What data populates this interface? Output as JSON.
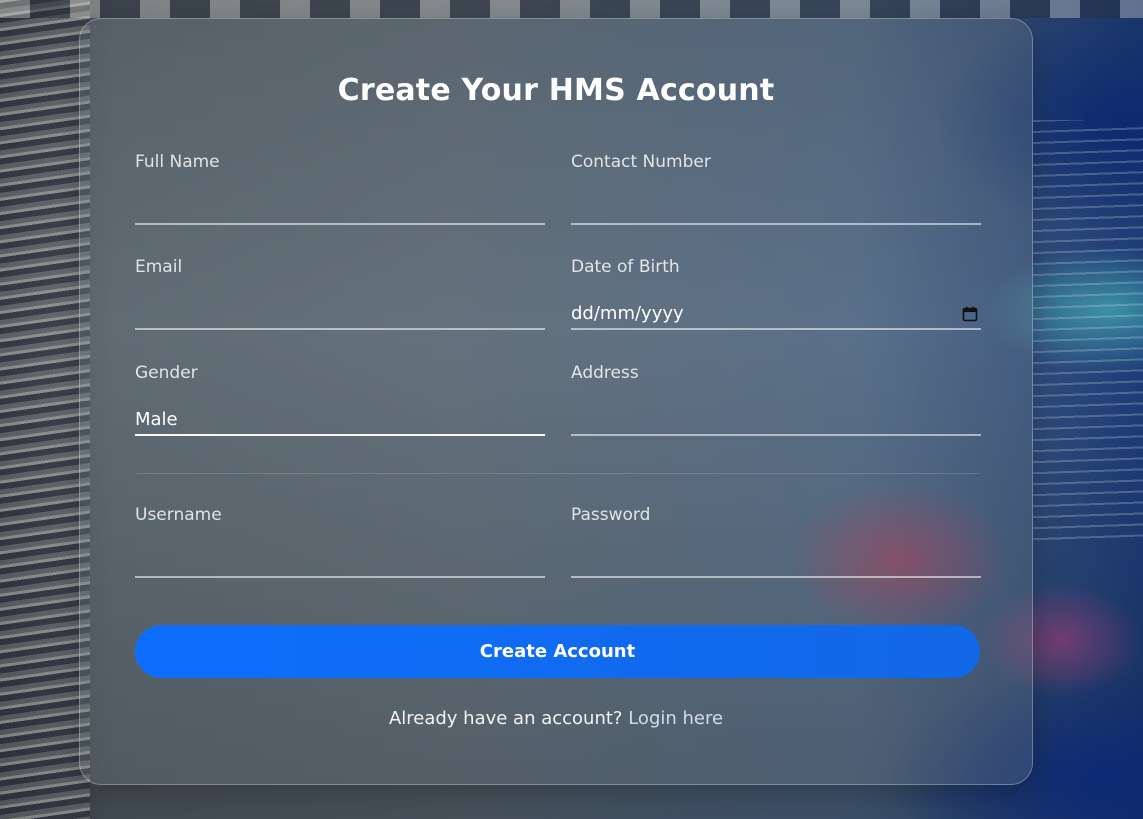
{
  "form": {
    "title": "Create Your HMS Account",
    "fields": {
      "full_name": {
        "label": "Full Name",
        "value": ""
      },
      "contact_number": {
        "label": "Contact Number",
        "value": ""
      },
      "email": {
        "label": "Email",
        "value": ""
      },
      "dob": {
        "label": "Date of Birth",
        "placeholder": "dd/mm/yyyy",
        "icon": "calendar-icon"
      },
      "gender": {
        "label": "Gender",
        "value": "Male"
      },
      "address": {
        "label": "Address",
        "value": ""
      },
      "username": {
        "label": "Username",
        "value": ""
      },
      "password": {
        "label": "Password",
        "value": ""
      }
    },
    "submit_label": "Create Account",
    "footer": {
      "prompt": "Already have an account?",
      "link_text": "Login here"
    }
  },
  "colors": {
    "button": "#0d6efd",
    "text": "#ffffff"
  }
}
